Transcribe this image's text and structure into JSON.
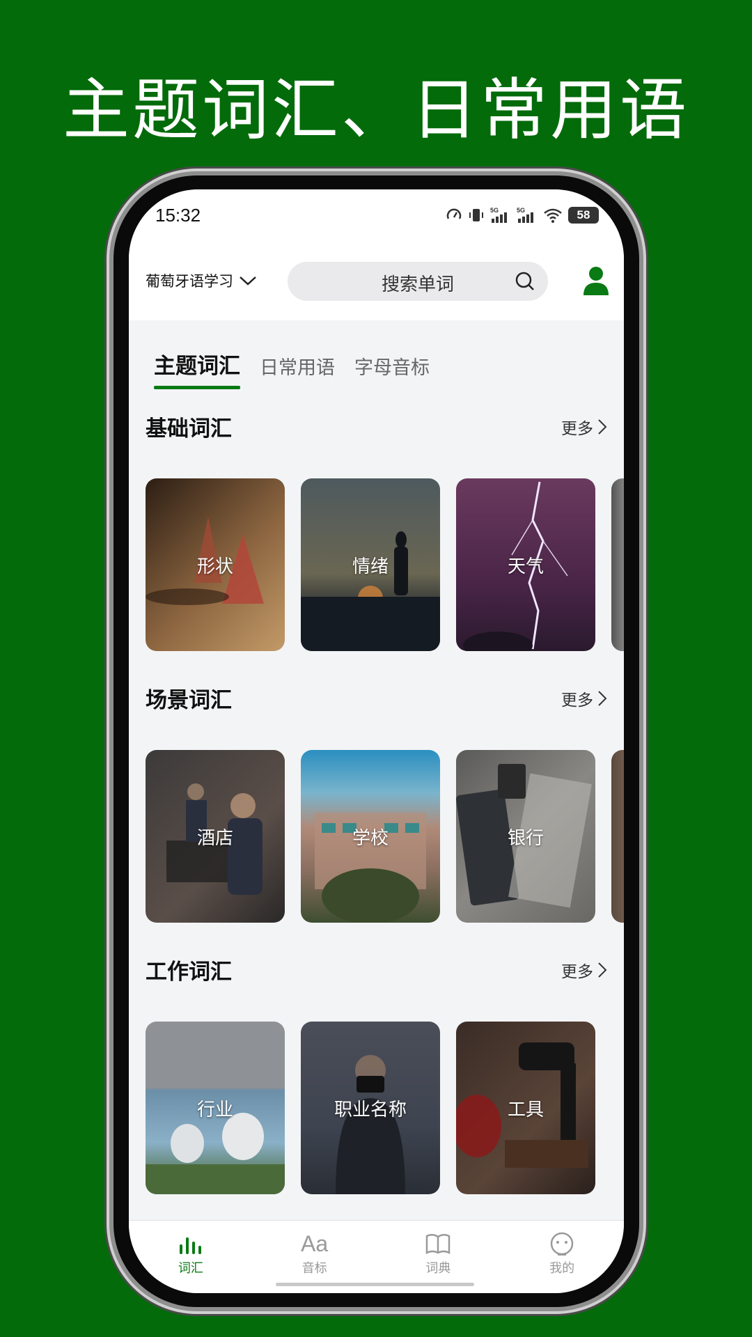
{
  "promo": {
    "title": "主题词汇、日常用语"
  },
  "status_bar": {
    "time": "15:32",
    "battery": "58",
    "net1": "5G",
    "net2": "5G"
  },
  "header": {
    "language": "葡萄牙语学习",
    "search_placeholder": "搜索单词"
  },
  "tabs": [
    {
      "label": "主题词汇",
      "active": true
    },
    {
      "label": "日常用语",
      "active": false
    },
    {
      "label": "字母音标",
      "active": false
    }
  ],
  "sections": [
    {
      "title": "基础词汇",
      "more": "更多",
      "cards": [
        {
          "label": "形状",
          "color": "#7a5a3a"
        },
        {
          "label": "情绪",
          "color": "#3e4a52"
        },
        {
          "label": "天气",
          "color": "#4a2a4e"
        }
      ]
    },
    {
      "title": "场景词汇",
      "more": "更多",
      "cards": [
        {
          "label": "酒店",
          "color": "#4a4644"
        },
        {
          "label": "学校",
          "color": "#6d7c78"
        },
        {
          "label": "银行",
          "color": "#75736e"
        }
      ]
    },
    {
      "title": "工作词汇",
      "more": "更多",
      "cards": [
        {
          "label": "行业",
          "color": "#8a9094"
        },
        {
          "label": "职业名称",
          "color": "#474b52"
        },
        {
          "label": "工具",
          "color": "#4c3c34"
        }
      ]
    }
  ],
  "bottom_nav": [
    {
      "label": "词汇",
      "icon": "bars-icon",
      "active": true
    },
    {
      "label": "音标",
      "icon": "Aa",
      "active": false
    },
    {
      "label": "词典",
      "icon": "book-icon",
      "active": false
    },
    {
      "label": "我的",
      "icon": "face-icon",
      "active": false
    }
  ],
  "colors": {
    "brand_green": "#0a7a14",
    "background_green": "#036b0a"
  }
}
